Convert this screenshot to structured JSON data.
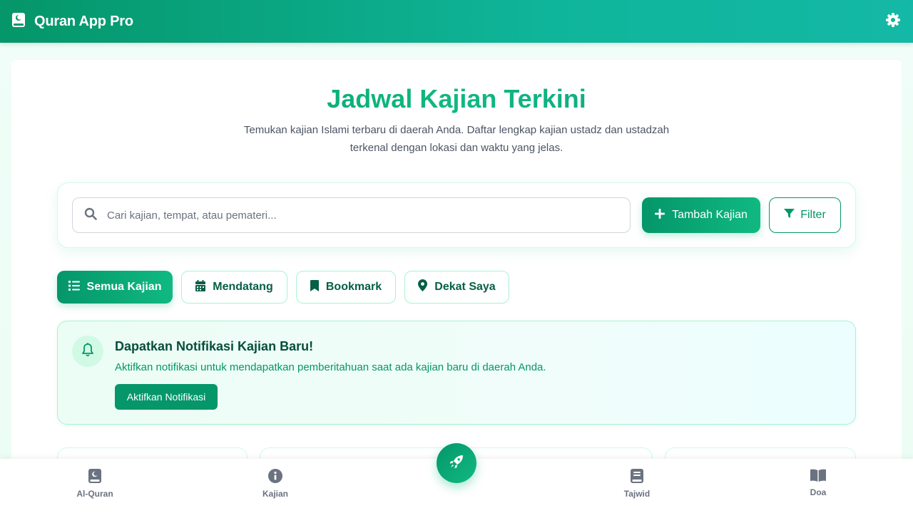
{
  "header": {
    "app_title": "Quran App Pro",
    "logo_icon": "quran-book-icon",
    "settings_icon": "gear-icon"
  },
  "hero": {
    "title": "Jadwal Kajian Terkini",
    "subtitle": "Temukan kajian Islami terbaru di daerah Anda. Daftar lengkap kajian ustadz dan ustadzah terkenal dengan lokasi dan waktu yang jelas."
  },
  "search": {
    "placeholder": "Cari kajian, tempat, atau pemateri...",
    "value": "",
    "add_label": "Tambah Kajian",
    "filter_label": "Filter"
  },
  "tabs": [
    {
      "label": "Semua Kajian",
      "icon": "list-icon",
      "active": true
    },
    {
      "label": "Mendatang",
      "icon": "calendar-icon",
      "active": false
    },
    {
      "label": "Bookmark",
      "icon": "bookmark-icon",
      "active": false
    },
    {
      "label": "Dekat Saya",
      "icon": "map-pin-icon",
      "active": false
    }
  ],
  "notification": {
    "title": "Dapatkan Notifikasi Kajian Baru!",
    "text": "Aktifkan notifikasi untuk mendapatkan pemberitahuan saat ada kajian baru di daerah Anda.",
    "button_label": "Aktifkan Notifikasi",
    "icon": "bell-icon"
  },
  "bottom_nav": [
    {
      "label": "Al-Quran",
      "icon": "quran-book-icon"
    },
    {
      "label": "Kajian",
      "icon": "info-icon"
    },
    {
      "label": "Tajwid",
      "icon": "book-icon"
    },
    {
      "label": "Doa",
      "icon": "open-book-icon"
    }
  ],
  "fab_icon": "rocket-icon",
  "colors": {
    "primary": "#059669",
    "accent": "#10b981",
    "teal": "#14b8a6"
  }
}
